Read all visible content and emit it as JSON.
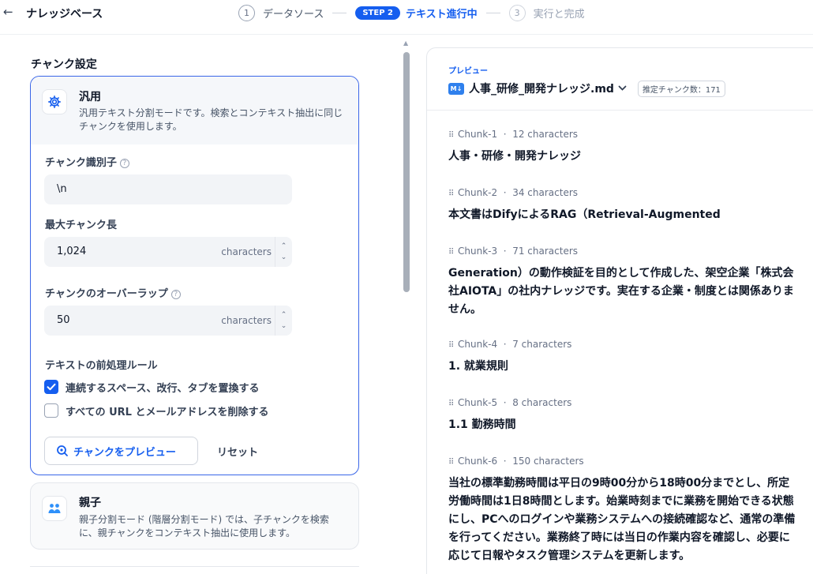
{
  "header": {
    "back_icon": "←",
    "title": "ナレッジベース",
    "steps": [
      {
        "num": "1",
        "label": "データソース"
      },
      {
        "badge": "STEP 2",
        "label": "テキスト進行中"
      },
      {
        "num": "3",
        "label": "実行と完成"
      }
    ]
  },
  "settings": {
    "section_title": "チャンク設定",
    "general": {
      "icon": "gear-icon",
      "name": "汎用",
      "desc": "汎用テキスト分割モードです。検索とコンテキスト抽出に同じチャンクを使用します。"
    },
    "separator": {
      "label": "チャンク識別子",
      "value": "\\n"
    },
    "max_length": {
      "label": "最大チャンク長",
      "value": "1,024",
      "unit": "characters"
    },
    "overlap": {
      "label": "チャンクのオーバーラップ",
      "value": "50",
      "unit": "characters"
    },
    "rules_title": "テキストの前処理ルール",
    "rule1": {
      "label": "連続するスペース、改行、タブを置換する",
      "checked": true
    },
    "rule2": {
      "label": "すべての URL とメールアドレスを削除する",
      "checked": false
    },
    "preview_button": "チャンクをプレビュー",
    "reset_button": "リセット",
    "parent_child": {
      "icon": "people-icon",
      "name": "親子",
      "desc": "親子分割モード (階層分割モード) では、子チャンクを検索に、親チャンクをコンテキスト抽出に使用します。"
    }
  },
  "preview": {
    "label": "プレビュー",
    "file_icon_text": "M↓",
    "file_name": "人事_研修_開発ナレッジ.md",
    "estimate": "推定チャンク数：171",
    "chunks": [
      {
        "id": "Chunk-1",
        "sep": "·",
        "count": "12 characters",
        "text": "人事・研修・開発ナレッジ"
      },
      {
        "id": "Chunk-2",
        "sep": "·",
        "count": "34 characters",
        "text": "本文書はDifyによるRAG（Retrieval-Augmented"
      },
      {
        "id": "Chunk-3",
        "sep": "·",
        "count": "71 characters",
        "text": "Generation）の動作検証を目的として作成した、架空企業「株式会社AIOTA」の社内ナレッジです。実在する企業・制度とは関係ありません。"
      },
      {
        "id": "Chunk-4",
        "sep": "·",
        "count": "7 characters",
        "text": "1. 就業規則"
      },
      {
        "id": "Chunk-5",
        "sep": "·",
        "count": "8 characters",
        "text": "1.1 勤務時間"
      },
      {
        "id": "Chunk-6",
        "sep": "·",
        "count": "150 characters",
        "text": "当社の標準勤務時間は平日の9時00分から18時00分までとし、所定労働時間は1日8時間とします。始業時刻までに業務を開始できる状態にし、PCへのログインや業務システムへの接続確認など、通常の準備を行ってください。業務終了時には当日の作業内容を確認し、必要に応じて日報やタスク管理システムを更新します。"
      }
    ]
  }
}
